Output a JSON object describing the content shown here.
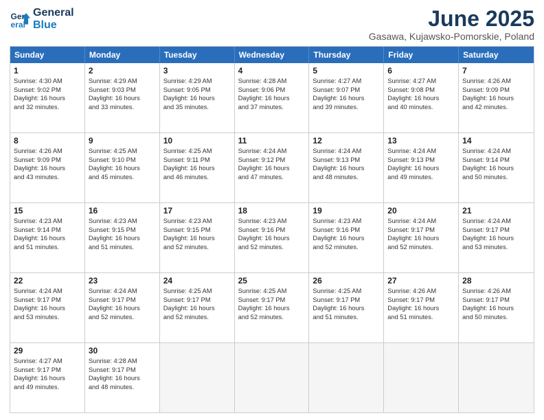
{
  "logo": {
    "line1": "General",
    "line2": "Blue"
  },
  "title": "June 2025",
  "subtitle": "Gasawa, Kujawsko-Pomorskie, Poland",
  "header_days": [
    "Sunday",
    "Monday",
    "Tuesday",
    "Wednesday",
    "Thursday",
    "Friday",
    "Saturday"
  ],
  "weeks": [
    [
      {
        "day": "1",
        "lines": [
          "Sunrise: 4:30 AM",
          "Sunset: 9:02 PM",
          "Daylight: 16 hours",
          "and 32 minutes."
        ]
      },
      {
        "day": "2",
        "lines": [
          "Sunrise: 4:29 AM",
          "Sunset: 9:03 PM",
          "Daylight: 16 hours",
          "and 33 minutes."
        ]
      },
      {
        "day": "3",
        "lines": [
          "Sunrise: 4:29 AM",
          "Sunset: 9:05 PM",
          "Daylight: 16 hours",
          "and 35 minutes."
        ]
      },
      {
        "day": "4",
        "lines": [
          "Sunrise: 4:28 AM",
          "Sunset: 9:06 PM",
          "Daylight: 16 hours",
          "and 37 minutes."
        ]
      },
      {
        "day": "5",
        "lines": [
          "Sunrise: 4:27 AM",
          "Sunset: 9:07 PM",
          "Daylight: 16 hours",
          "and 39 minutes."
        ]
      },
      {
        "day": "6",
        "lines": [
          "Sunrise: 4:27 AM",
          "Sunset: 9:08 PM",
          "Daylight: 16 hours",
          "and 40 minutes."
        ]
      },
      {
        "day": "7",
        "lines": [
          "Sunrise: 4:26 AM",
          "Sunset: 9:09 PM",
          "Daylight: 16 hours",
          "and 42 minutes."
        ]
      }
    ],
    [
      {
        "day": "8",
        "lines": [
          "Sunrise: 4:26 AM",
          "Sunset: 9:09 PM",
          "Daylight: 16 hours",
          "and 43 minutes."
        ]
      },
      {
        "day": "9",
        "lines": [
          "Sunrise: 4:25 AM",
          "Sunset: 9:10 PM",
          "Daylight: 16 hours",
          "and 45 minutes."
        ]
      },
      {
        "day": "10",
        "lines": [
          "Sunrise: 4:25 AM",
          "Sunset: 9:11 PM",
          "Daylight: 16 hours",
          "and 46 minutes."
        ]
      },
      {
        "day": "11",
        "lines": [
          "Sunrise: 4:24 AM",
          "Sunset: 9:12 PM",
          "Daylight: 16 hours",
          "and 47 minutes."
        ]
      },
      {
        "day": "12",
        "lines": [
          "Sunrise: 4:24 AM",
          "Sunset: 9:13 PM",
          "Daylight: 16 hours",
          "and 48 minutes."
        ]
      },
      {
        "day": "13",
        "lines": [
          "Sunrise: 4:24 AM",
          "Sunset: 9:13 PM",
          "Daylight: 16 hours",
          "and 49 minutes."
        ]
      },
      {
        "day": "14",
        "lines": [
          "Sunrise: 4:24 AM",
          "Sunset: 9:14 PM",
          "Daylight: 16 hours",
          "and 50 minutes."
        ]
      }
    ],
    [
      {
        "day": "15",
        "lines": [
          "Sunrise: 4:23 AM",
          "Sunset: 9:14 PM",
          "Daylight: 16 hours",
          "and 51 minutes."
        ]
      },
      {
        "day": "16",
        "lines": [
          "Sunrise: 4:23 AM",
          "Sunset: 9:15 PM",
          "Daylight: 16 hours",
          "and 51 minutes."
        ]
      },
      {
        "day": "17",
        "lines": [
          "Sunrise: 4:23 AM",
          "Sunset: 9:15 PM",
          "Daylight: 16 hours",
          "and 52 minutes."
        ]
      },
      {
        "day": "18",
        "lines": [
          "Sunrise: 4:23 AM",
          "Sunset: 9:16 PM",
          "Daylight: 16 hours",
          "and 52 minutes."
        ]
      },
      {
        "day": "19",
        "lines": [
          "Sunrise: 4:23 AM",
          "Sunset: 9:16 PM",
          "Daylight: 16 hours",
          "and 52 minutes."
        ]
      },
      {
        "day": "20",
        "lines": [
          "Sunrise: 4:24 AM",
          "Sunset: 9:17 PM",
          "Daylight: 16 hours",
          "and 52 minutes."
        ]
      },
      {
        "day": "21",
        "lines": [
          "Sunrise: 4:24 AM",
          "Sunset: 9:17 PM",
          "Daylight: 16 hours",
          "and 53 minutes."
        ]
      }
    ],
    [
      {
        "day": "22",
        "lines": [
          "Sunrise: 4:24 AM",
          "Sunset: 9:17 PM",
          "Daylight: 16 hours",
          "and 53 minutes."
        ]
      },
      {
        "day": "23",
        "lines": [
          "Sunrise: 4:24 AM",
          "Sunset: 9:17 PM",
          "Daylight: 16 hours",
          "and 52 minutes."
        ]
      },
      {
        "day": "24",
        "lines": [
          "Sunrise: 4:25 AM",
          "Sunset: 9:17 PM",
          "Daylight: 16 hours",
          "and 52 minutes."
        ]
      },
      {
        "day": "25",
        "lines": [
          "Sunrise: 4:25 AM",
          "Sunset: 9:17 PM",
          "Daylight: 16 hours",
          "and 52 minutes."
        ]
      },
      {
        "day": "26",
        "lines": [
          "Sunrise: 4:25 AM",
          "Sunset: 9:17 PM",
          "Daylight: 16 hours",
          "and 51 minutes."
        ]
      },
      {
        "day": "27",
        "lines": [
          "Sunrise: 4:26 AM",
          "Sunset: 9:17 PM",
          "Daylight: 16 hours",
          "and 51 minutes."
        ]
      },
      {
        "day": "28",
        "lines": [
          "Sunrise: 4:26 AM",
          "Sunset: 9:17 PM",
          "Daylight: 16 hours",
          "and 50 minutes."
        ]
      }
    ],
    [
      {
        "day": "29",
        "lines": [
          "Sunrise: 4:27 AM",
          "Sunset: 9:17 PM",
          "Daylight: 16 hours",
          "and 49 minutes."
        ]
      },
      {
        "day": "30",
        "lines": [
          "Sunrise: 4:28 AM",
          "Sunset: 9:17 PM",
          "Daylight: 16 hours",
          "and 48 minutes."
        ]
      },
      {
        "day": "",
        "lines": [],
        "empty": true
      },
      {
        "day": "",
        "lines": [],
        "empty": true
      },
      {
        "day": "",
        "lines": [],
        "empty": true
      },
      {
        "day": "",
        "lines": [],
        "empty": true
      },
      {
        "day": "",
        "lines": [],
        "empty": true
      }
    ]
  ]
}
